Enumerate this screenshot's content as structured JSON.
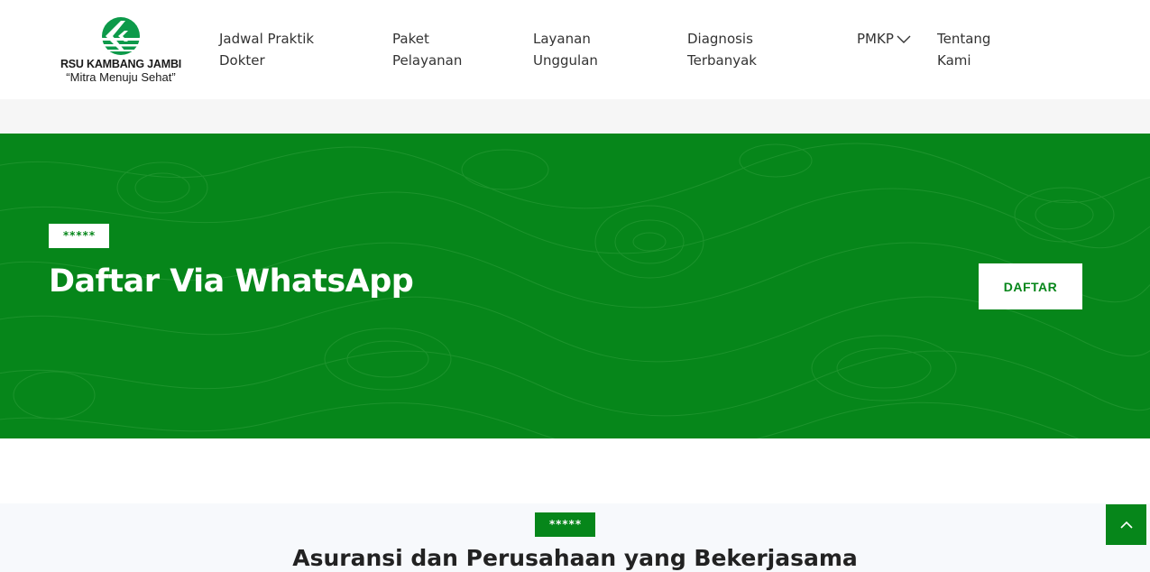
{
  "brand": {
    "name": "RSU KAMBANG JAMBI",
    "tagline": "“Mitra Menuju Sehat”",
    "logo_icon": "kambang-logo-icon",
    "colors": {
      "primary": "#06861a",
      "logo_green": "#0d9a4a"
    }
  },
  "nav": {
    "items": [
      {
        "line1": "Jadwal Praktik",
        "line2": "Dokter"
      },
      {
        "line1": "Paket",
        "line2": "Pelayanan"
      },
      {
        "line1": "Layanan",
        "line2": "Unggulan"
      },
      {
        "line1": "Diagnosis",
        "line2": "Terbanyak"
      },
      {
        "line1": "PMKP",
        "line2": ""
      },
      {
        "line1": "Tentang",
        "line2": "Kami"
      }
    ],
    "pmkp_icon": "chevron-down-icon"
  },
  "cta": {
    "badge": "*****",
    "title": "Daftar Via WhatsApp",
    "button": "DAFTAR"
  },
  "partners": {
    "badge": "*****",
    "title": "Asuransi dan Perusahaan yang Bekerjasama"
  },
  "scroll_top": {
    "icon": "chevron-up-icon"
  }
}
